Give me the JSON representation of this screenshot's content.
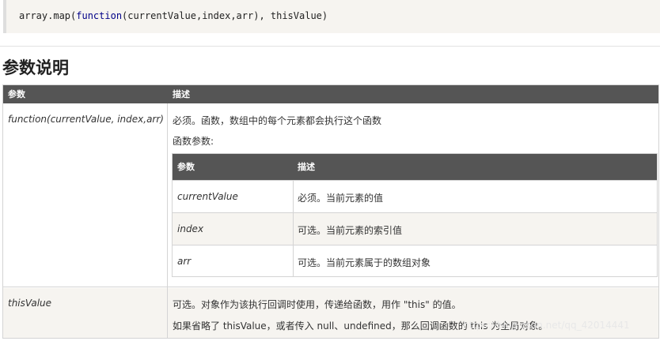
{
  "code": {
    "prefix": "array.map(",
    "keyword": "function",
    "suffix": "(currentValue,index,arr), thisValue)"
  },
  "heading": "参数说明",
  "table": {
    "headers": [
      "参数",
      "描述"
    ],
    "rows": [
      {
        "param": "function(currentValue, index,arr)",
        "desc_line1": "必须。函数，数组中的每个元素都会执行这个函数",
        "desc_line2": "函数参数:"
      },
      {
        "param": "thisValue",
        "desc_line1": "可选。对象作为该执行回调时使用，传递给函数，用作 \"this\" 的值。",
        "desc_line2": "如果省略了 thisValue，或者传入 null、undefined，那么回调函数的 this 为全局对象。"
      }
    ]
  },
  "inner_table": {
    "headers": [
      "参数",
      "描述"
    ],
    "rows": [
      {
        "param": "currentValue",
        "desc": "必须。当前元素的值"
      },
      {
        "param": "index",
        "desc": "可选。当前元素的索引值"
      },
      {
        "param": "arr",
        "desc": "可选。当前元素属于的数组对象"
      }
    ]
  },
  "watermark": "https://blog.csdn.net/qq_42014441"
}
